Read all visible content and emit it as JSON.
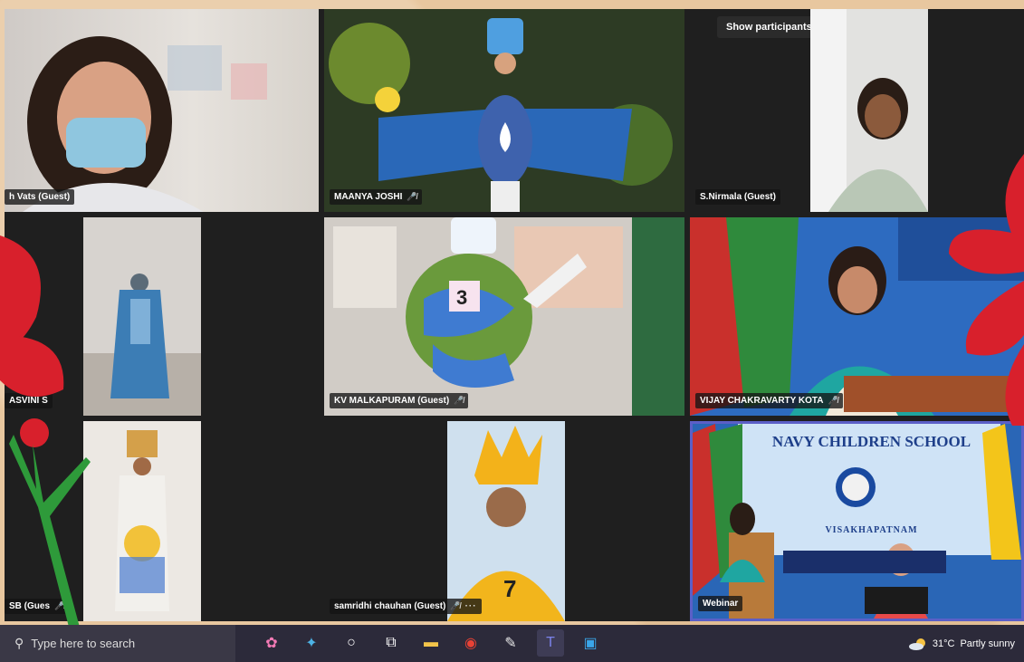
{
  "meeting": {
    "show_participants": "Show participants",
    "tiles": [
      {
        "name": "h Vats (Guest)"
      },
      {
        "name": "MAANYA JOSHI"
      },
      {
        "name": "S.Nirmala (Guest)"
      },
      {
        "name": "ASVINI S"
      },
      {
        "name": "KV MALKAPURAM (Guest)"
      },
      {
        "name": "VIJAY CHAKRAVARTY KOTA"
      },
      {
        "name": "SB (Gues"
      },
      {
        "name": "samridhi chauhan (Guest)"
      },
      {
        "name": "Webinar"
      }
    ],
    "banner_title": "NAVY CHILDREN SCHOOL",
    "banner_sub": "VISAKHAPATNAM",
    "costume_number": "3",
    "costume_number_2": "7"
  },
  "taskbar": {
    "search_placeholder": "Type here to search",
    "weather_temp": "31°C",
    "weather_desc": "Partly sunny"
  },
  "colors": {
    "accent": "#5b5fc7",
    "flower_red": "#d8202c",
    "stem_green": "#2e9a3a"
  }
}
